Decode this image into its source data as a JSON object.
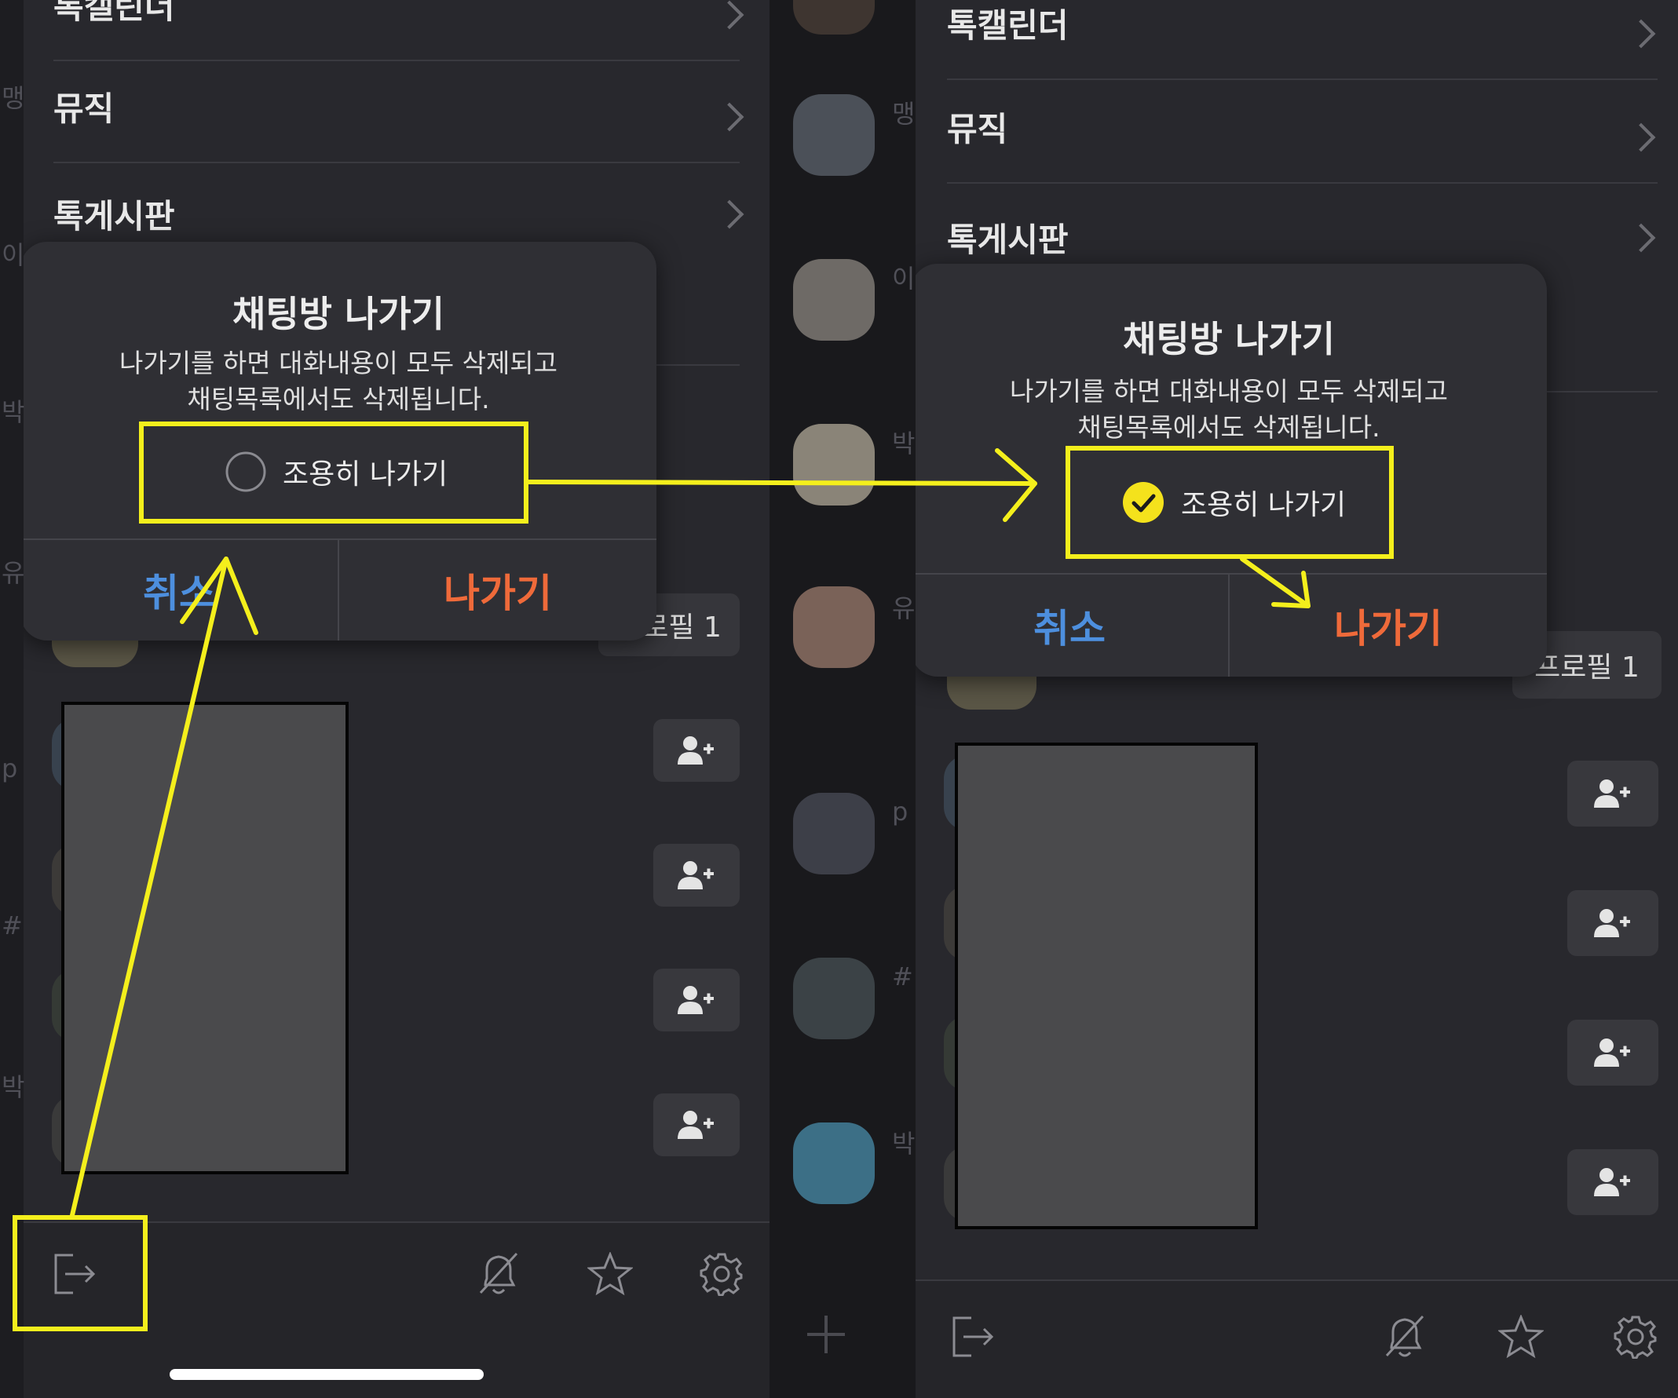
{
  "menu": {
    "items": [
      {
        "label": "톡캘린더"
      },
      {
        "label": "뮤직"
      },
      {
        "label": "톡게시판"
      }
    ]
  },
  "dialog": {
    "title": "채팅방 나가기",
    "message_line1": "나가기를 하면 대화내용이 모두 삭제되고",
    "message_line2": "채팅목록에서도 삭제됩니다.",
    "quiet_leave_label": "조용히 나가기",
    "cancel_label": "취소",
    "leave_label": "나가기"
  },
  "left_state": {
    "quiet_leave_checked": false
  },
  "right_state": {
    "quiet_leave_checked": true
  },
  "profile_chip": "프로필 1",
  "sidebar_peek_left": [
    "맹",
    "이",
    "박",
    "유",
    "p",
    "#",
    "박"
  ],
  "sidebar_peek_right": [
    "맹",
    "이",
    "박",
    "유",
    "p",
    "#",
    "박"
  ],
  "icons": {
    "bottom_bar": [
      "exit-icon",
      "bell-off-icon",
      "star-icon",
      "gear-icon"
    ],
    "member_row": "add-friend-icon",
    "new_chat": "plus-icon"
  },
  "colors": {
    "highlight": "#f4ef1c",
    "cancel": "#4d8fde",
    "leave": "#ef6a3a",
    "checked": "#f4e21c"
  }
}
